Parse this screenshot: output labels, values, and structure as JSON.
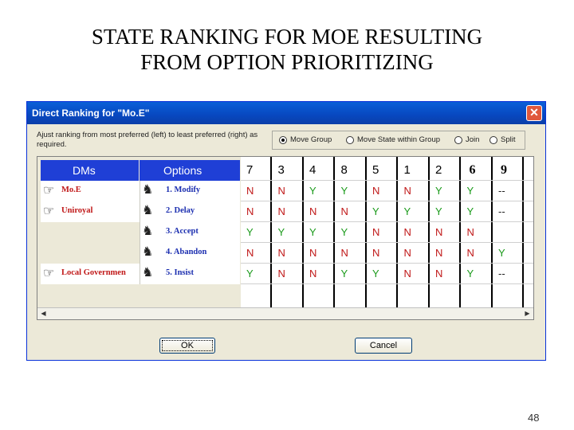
{
  "slide": {
    "title_line1": "STATE RANKING FOR MOE RESULTING",
    "title_line2": "FROM OPTION PRIORITIZING",
    "page_number": "48"
  },
  "dialog": {
    "title": "Direct Ranking for \"Mo.E\"",
    "close_label": "✕",
    "instruction": "Ajust ranking from most preferred (left) to least preferred (right) as required.",
    "radio_options": [
      {
        "label": "Move Group",
        "selected": true
      },
      {
        "label": "Move State within Group",
        "selected": false
      },
      {
        "label": "Join",
        "selected": false
      },
      {
        "label": "Split",
        "selected": false
      }
    ],
    "headers": {
      "dms": "DMs",
      "options": "Options"
    },
    "rows": [
      {
        "dm": "Mo.E",
        "option": "1. Modify"
      },
      {
        "dm": "Uniroyal",
        "option": "2. Delay"
      },
      {
        "dm": "",
        "option": "3. Accept"
      },
      {
        "dm": "",
        "option": "4. Abandon"
      },
      {
        "dm": "Local Governmen",
        "option": "5. Insist"
      }
    ],
    "states": [
      {
        "label": "7",
        "values": [
          "N",
          "N",
          "Y",
          "N",
          "Y"
        ]
      },
      {
        "label": "3",
        "values": [
          "N",
          "N",
          "Y",
          "N",
          "N"
        ]
      },
      {
        "label": "4",
        "values": [
          "Y",
          "N",
          "Y",
          "N",
          "N"
        ]
      },
      {
        "label": "8",
        "values": [
          "Y",
          "N",
          "Y",
          "N",
          "Y"
        ]
      },
      {
        "label": "5",
        "values": [
          "N",
          "Y",
          "N",
          "N",
          "Y"
        ]
      },
      {
        "label": "1",
        "values": [
          "N",
          "Y",
          "N",
          "N",
          "N"
        ]
      },
      {
        "label": "2",
        "values": [
          "Y",
          "Y",
          "N",
          "N",
          "N"
        ]
      },
      {
        "label": "6",
        "values": [
          "Y",
          "Y",
          "N",
          "N",
          "Y"
        ]
      },
      {
        "label": "9",
        "values": [
          "--",
          "--",
          "",
          "Y",
          "--"
        ]
      }
    ],
    "ok_label": "OK",
    "cancel_label": "Cancel"
  },
  "colors": {
    "header_blue": "#1f3fd6",
    "dm_red": "#c01818",
    "option_blue": "#1c2fb0",
    "yes_green": "#1a9a1a",
    "no_red": "#c01818"
  },
  "icons": {
    "dm": "person-pointing-icon",
    "option": "chess-knight-icon"
  }
}
